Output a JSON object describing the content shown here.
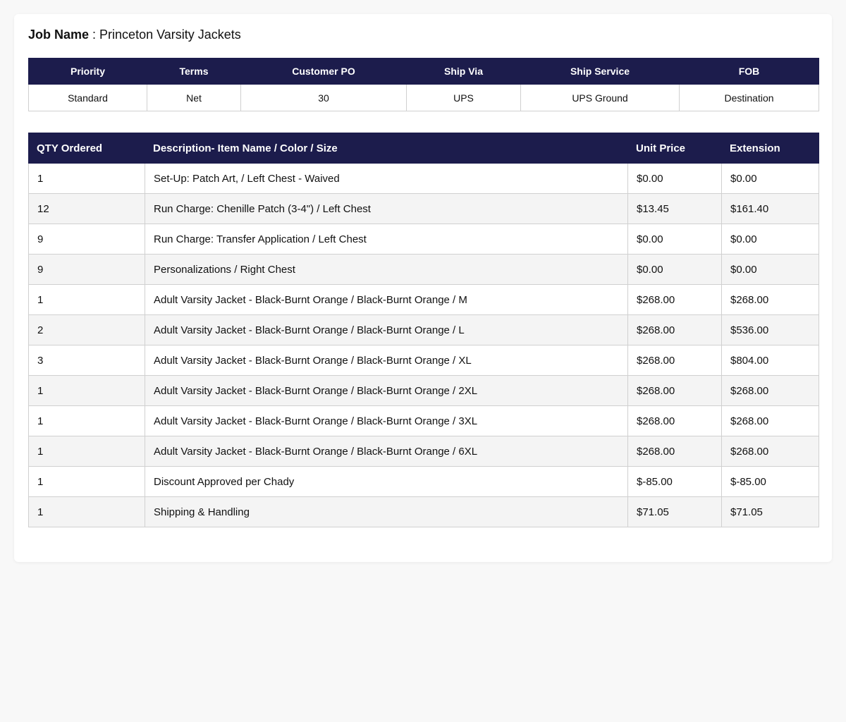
{
  "job": {
    "label": "Job Name",
    "separator": " : ",
    "value": "Princeton Varsity Jackets"
  },
  "order_info": {
    "headers": [
      "Priority",
      "Terms",
      "Customer PO",
      "Ship Via",
      "Ship Service",
      "FOB"
    ],
    "values": [
      "Standard",
      "Net",
      "30",
      "UPS",
      "UPS Ground",
      "Destination"
    ]
  },
  "line_items": {
    "headers": [
      "QTY Ordered",
      "Description- Item Name / Color / Size",
      "Unit Price",
      "Extension"
    ],
    "rows": [
      [
        "1",
        "Set-Up: Patch Art, / Left Chest - Waived",
        "$0.00",
        "$0.00"
      ],
      [
        "12",
        "Run Charge: Chenille Patch (3-4\") / Left Chest",
        "$13.45",
        "$161.40"
      ],
      [
        "9",
        "Run Charge: Transfer Application / Left Chest",
        "$0.00",
        "$0.00"
      ],
      [
        "9",
        "Personalizations / Right Chest",
        "$0.00",
        "$0.00"
      ],
      [
        "1",
        "Adult Varsity Jacket - Black-Burnt Orange / Black-Burnt Orange / M",
        "$268.00",
        "$268.00"
      ],
      [
        "2",
        "Adult Varsity Jacket - Black-Burnt Orange / Black-Burnt Orange / L",
        "$268.00",
        "$536.00"
      ],
      [
        "3",
        "Adult Varsity Jacket - Black-Burnt Orange / Black-Burnt Orange / XL",
        "$268.00",
        "$804.00"
      ],
      [
        "1",
        "Adult Varsity Jacket - Black-Burnt Orange / Black-Burnt Orange / 2XL",
        "$268.00",
        "$268.00"
      ],
      [
        "1",
        "Adult Varsity Jacket - Black-Burnt Orange / Black-Burnt Orange / 3XL",
        "$268.00",
        "$268.00"
      ],
      [
        "1",
        "Adult Varsity Jacket - Black-Burnt Orange / Black-Burnt Orange / 6XL",
        "$268.00",
        "$268.00"
      ],
      [
        "1",
        "Discount Approved per Chady",
        "$-85.00",
        "$-85.00"
      ],
      [
        "1",
        "Shipping & Handling",
        "$71.05",
        "$71.05"
      ]
    ]
  },
  "colors": {
    "header_bg": "#1c1c4c",
    "header_text": "#ffffff",
    "alt_row_bg": "#f4f4f4",
    "page_bg": "#f8f8f8"
  }
}
